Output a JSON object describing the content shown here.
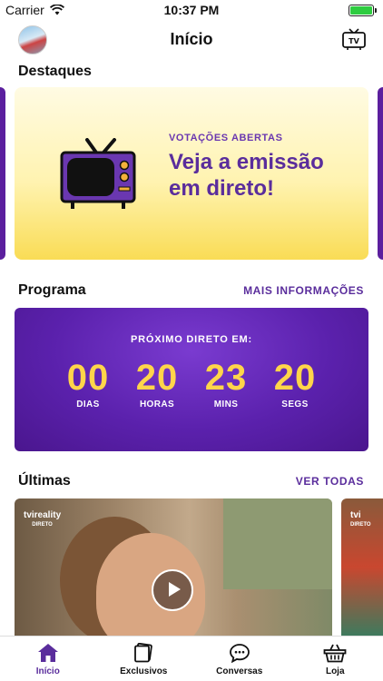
{
  "status_bar": {
    "carrier": "Carrier",
    "time": "10:37 PM"
  },
  "nav": {
    "title": "Início",
    "tv_icon": "tv-icon"
  },
  "highlights": {
    "title": "Destaques",
    "card": {
      "eyebrow": "VOTAÇÕES ABERTAS",
      "headline": "Veja a emissão em direto!",
      "icon": "retro-tv-icon"
    }
  },
  "program": {
    "title": "Programa",
    "link": "MAIS INFORMAÇÕES",
    "countdown_label": "PRÓXIMO DIRETO EM:",
    "units": [
      {
        "value": "00",
        "label": "DIAS"
      },
      {
        "value": "20",
        "label": "HORAS"
      },
      {
        "value": "23",
        "label": "MINS"
      },
      {
        "value": "20",
        "label": "SEGS"
      }
    ]
  },
  "latest": {
    "title": "Últimas",
    "link": "VER TODAS",
    "videos": [
      {
        "logo": "tvireality",
        "logo_sub": "DIRETO"
      },
      {
        "logo": "tvi",
        "logo_sub": "DIRETO"
      }
    ]
  },
  "tabs": [
    {
      "label": "Início",
      "icon": "home-icon",
      "active": true
    },
    {
      "label": "Exclusivos",
      "icon": "cards-icon",
      "active": false
    },
    {
      "label": "Conversas",
      "icon": "chat-bubble-icon",
      "active": false
    },
    {
      "label": "Loja",
      "icon": "basket-icon",
      "active": false
    }
  ],
  "colors": {
    "brand_purple": "#5a2d9c",
    "countdown_gold": "#ffd54a",
    "hero_yellow": "#f9dc55"
  }
}
